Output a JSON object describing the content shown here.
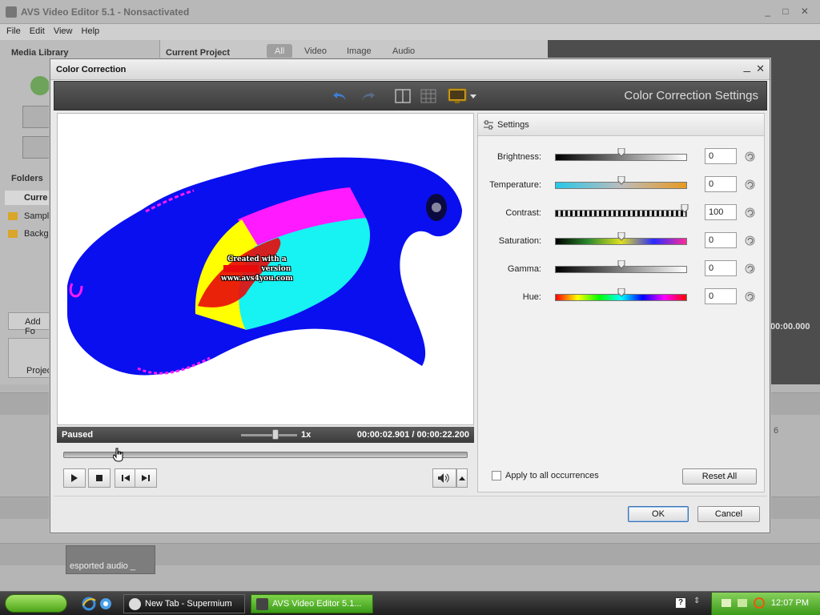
{
  "app": {
    "title": "AVS Video Editor 5.1 - Nonsactivated",
    "menu": [
      "File",
      "Edit",
      "View",
      "Help"
    ],
    "media_library_label": "Media Library",
    "current_project_label": "Current Project",
    "project_tabs": [
      "All",
      "Video",
      "Image",
      "Audio"
    ],
    "folders_label": "Folders",
    "folder_items": [
      "Curre",
      "Sampl",
      "Backgi"
    ],
    "add_folder_label": "Add Fo",
    "project_label": "Projec",
    "audio_clip_label": "esported audio _",
    "right_time": "00:00.000",
    "ruler_mark": "6"
  },
  "dialog": {
    "title": "Color Correction",
    "minimize_glyph": "_",
    "close_glyph": "✕",
    "settings_heading": "Color Correction Settings",
    "toolbar_icons": [
      "undo-icon",
      "redo-icon",
      "split-view-icon",
      "grid-view-icon",
      "monitor-icon",
      "dropdown-arrow-icon"
    ]
  },
  "preview": {
    "watermark_line1": "Created with a",
    "watermark_line2": "version",
    "watermark_line3": "www.avs4you.com"
  },
  "player": {
    "status": "Paused",
    "speed": "1x",
    "current_time": "00:00:02.901",
    "separator": "/",
    "total_time": "00:00:22.200",
    "seek_position": 0.135
  },
  "settings": {
    "panel_label": "Settings",
    "rows": [
      {
        "label": "Brightness:",
        "value": "0",
        "knob": 0.5
      },
      {
        "label": "Temperature:",
        "value": "0",
        "knob": 0.5
      },
      {
        "label": "Contrast:",
        "value": "100",
        "knob": 1.0
      },
      {
        "label": "Saturation:",
        "value": "0",
        "knob": 0.5
      },
      {
        "label": "Gamma:",
        "value": "0",
        "knob": 0.5
      },
      {
        "label": "Hue:",
        "value": "0",
        "knob": 0.5
      }
    ],
    "apply_all_label": "Apply to all occurrences",
    "apply_all_checked": false,
    "reset_all_label": "Reset All"
  },
  "buttons": {
    "ok": "OK",
    "cancel": "Cancel"
  },
  "taskbar": {
    "tasks": [
      {
        "label": "New Tab - Supermium",
        "icon": "browser-icon"
      },
      {
        "label": "AVS Video Editor 5.1...",
        "icon": "avs-icon"
      }
    ],
    "clock": "12:07 PM"
  },
  "colors": {
    "accent_green": "#4ea417",
    "toolbar_dark": "#3c3c3c",
    "blue_shape": "#0a0ff0",
    "magenta_band": "#ff1aff",
    "cyan_band": "#17f2f2",
    "yellow_band": "#ffff00",
    "red_band": "#e80a0a"
  }
}
